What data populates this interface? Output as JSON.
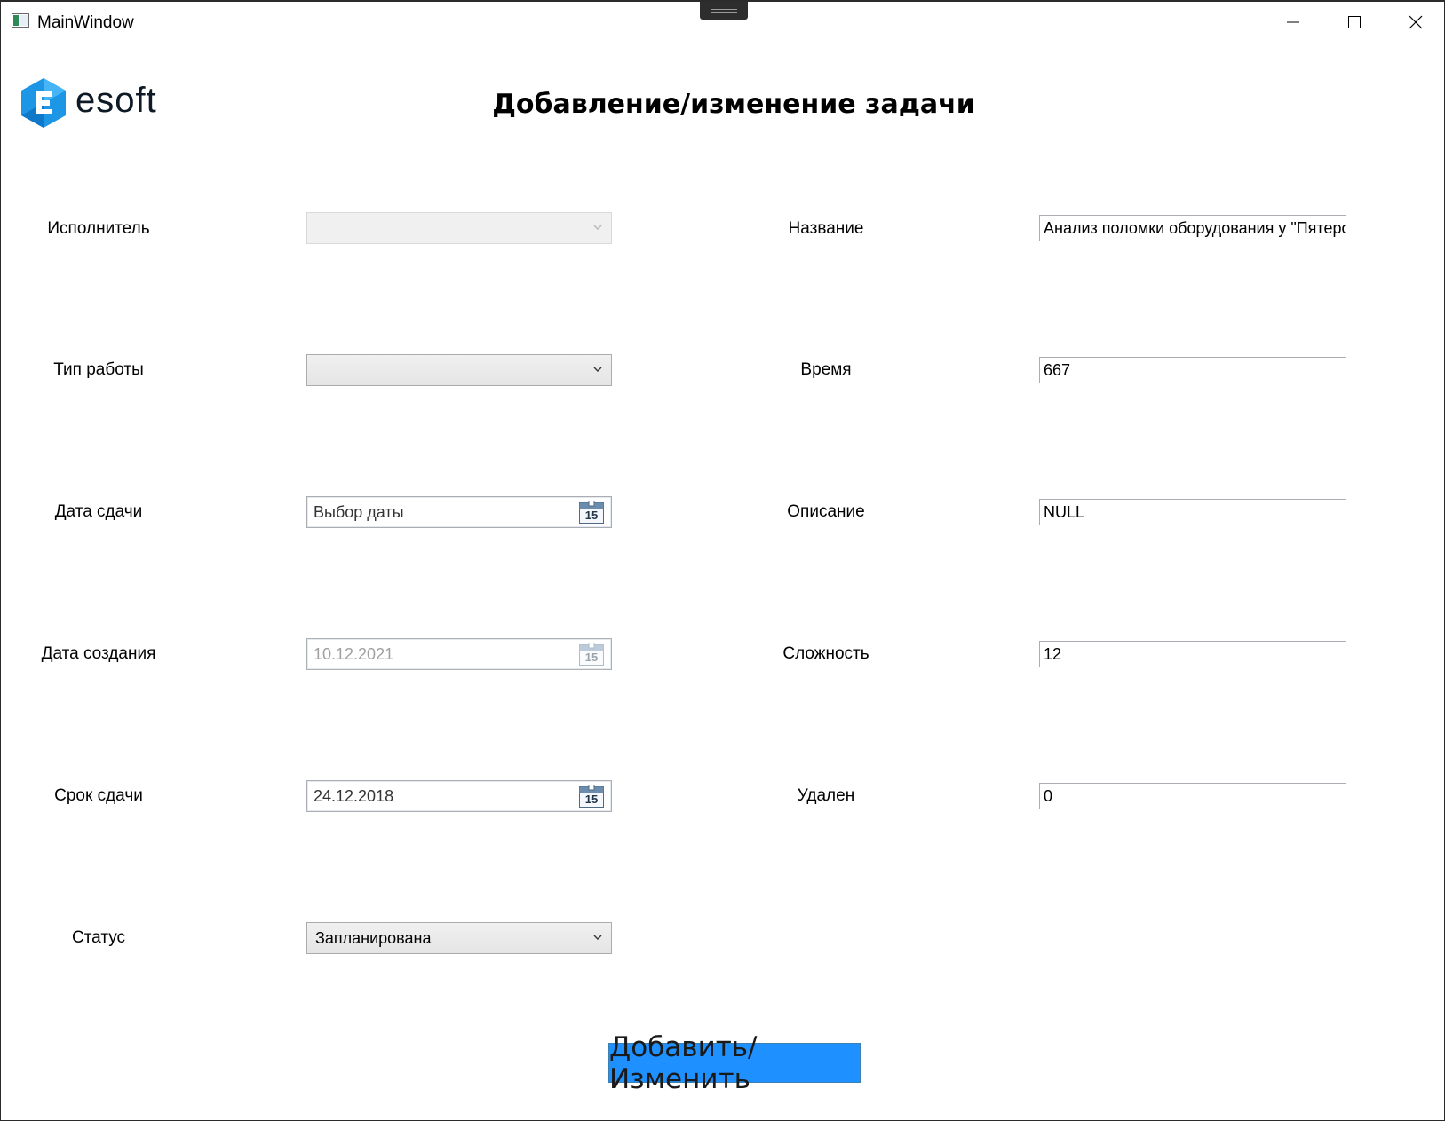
{
  "window": {
    "title": "MainWindow",
    "controls": {
      "minimize": "minimize",
      "maximize": "maximize",
      "close": "close"
    }
  },
  "logo": {
    "text": "esoft",
    "brand_color": "#1e96e6"
  },
  "page_title": "Добавление/изменение задачи",
  "left_fields": {
    "executor": {
      "label": "Исполнитель",
      "value": "",
      "disabled": true
    },
    "work_type": {
      "label": "Тип работы",
      "value": ""
    },
    "due_date": {
      "label": "Дата сдачи",
      "value": "Выбор даты",
      "calendar_day": "15"
    },
    "created_date": {
      "label": "Дата создания",
      "value": "10.12.2021",
      "calendar_day": "15",
      "disabled": true
    },
    "deadline": {
      "label": "Срок сдачи",
      "value": "24.12.2018",
      "calendar_day": "15"
    },
    "status": {
      "label": "Статус",
      "value": "Запланирована"
    }
  },
  "right_fields": {
    "name": {
      "label": "Название",
      "value": "Анализ поломки оборудования у \"Пятерочки\""
    },
    "time": {
      "label": "Время",
      "value": "667"
    },
    "description": {
      "label": "Описание",
      "value": "NULL"
    },
    "complexity": {
      "label": "Сложность",
      "value": "12"
    },
    "deleted": {
      "label": "Удален",
      "value": "0"
    }
  },
  "submit_button": {
    "label": "Добавить/Изменить",
    "color": "#1e90ff"
  }
}
